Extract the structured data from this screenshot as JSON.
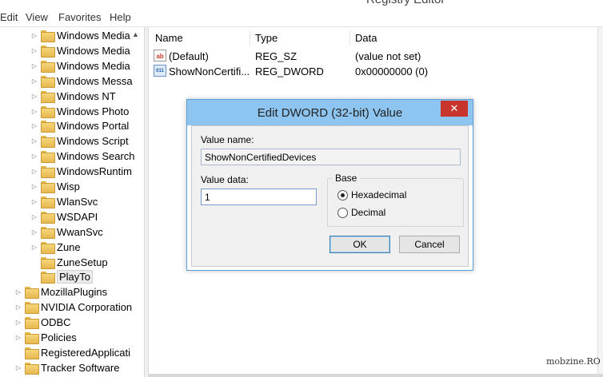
{
  "window": {
    "title": "Registry Editor"
  },
  "menu": [
    "Edit",
    "View",
    "Favorites",
    "Help"
  ],
  "tree": {
    "items": [
      {
        "label": "Windows Media",
        "expandable": true
      },
      {
        "label": "Windows Media",
        "expandable": true
      },
      {
        "label": "Windows Media",
        "expandable": true
      },
      {
        "label": "Windows Messa",
        "expandable": true
      },
      {
        "label": "Windows NT",
        "expandable": true
      },
      {
        "label": "Windows Photo",
        "expandable": true
      },
      {
        "label": "Windows Portal",
        "expandable": true
      },
      {
        "label": "Windows Script",
        "expandable": true
      },
      {
        "label": "Windows Search",
        "expandable": true
      },
      {
        "label": "WindowsRuntim",
        "expandable": true
      },
      {
        "label": "Wisp",
        "expandable": true
      },
      {
        "label": "WlanSvc",
        "expandable": true
      },
      {
        "label": "WSDAPI",
        "expandable": true
      },
      {
        "label": "WwanSvc",
        "expandable": true
      },
      {
        "label": "Zune",
        "expandable": true
      },
      {
        "label": "ZuneSetup",
        "expandable": false
      },
      {
        "label": "PlayTo",
        "expandable": false,
        "selected": true
      },
      {
        "label": "MozillaPlugins",
        "expandable": true
      },
      {
        "label": "NVIDIA Corporation",
        "expandable": true
      },
      {
        "label": "ODBC",
        "expandable": true
      },
      {
        "label": "Policies",
        "expandable": true
      },
      {
        "label": "RegisteredApplicati",
        "expandable": false
      },
      {
        "label": "Tracker Software",
        "expandable": true
      }
    ]
  },
  "list": {
    "columns": [
      "Name",
      "Type",
      "Data"
    ],
    "rows": [
      {
        "icon": "string-value-icon",
        "name": "(Default)",
        "type": "REG_SZ",
        "data": "(value not set)"
      },
      {
        "icon": "binary-value-icon",
        "name": "ShowNonCertifi...",
        "type": "REG_DWORD",
        "data": "0x00000000 (0)"
      }
    ]
  },
  "dialog": {
    "title": "Edit DWORD (32-bit) Value",
    "close_glyph": "✕",
    "value_name_label": "Value name:",
    "value_name": "ShowNonCertifiedDevices",
    "value_data_label": "Value data:",
    "value_data": "1",
    "base_label": "Base",
    "hex_label": "Hexadecimal",
    "dec_label": "Decimal",
    "ok_label": "OK",
    "cancel_label": "Cancel"
  },
  "watermark": "mobzine.RO",
  "colors": {
    "dialog_title_bg": "#8ec5f0",
    "close_button": "#c7352d",
    "folder": "#f6d67a"
  }
}
